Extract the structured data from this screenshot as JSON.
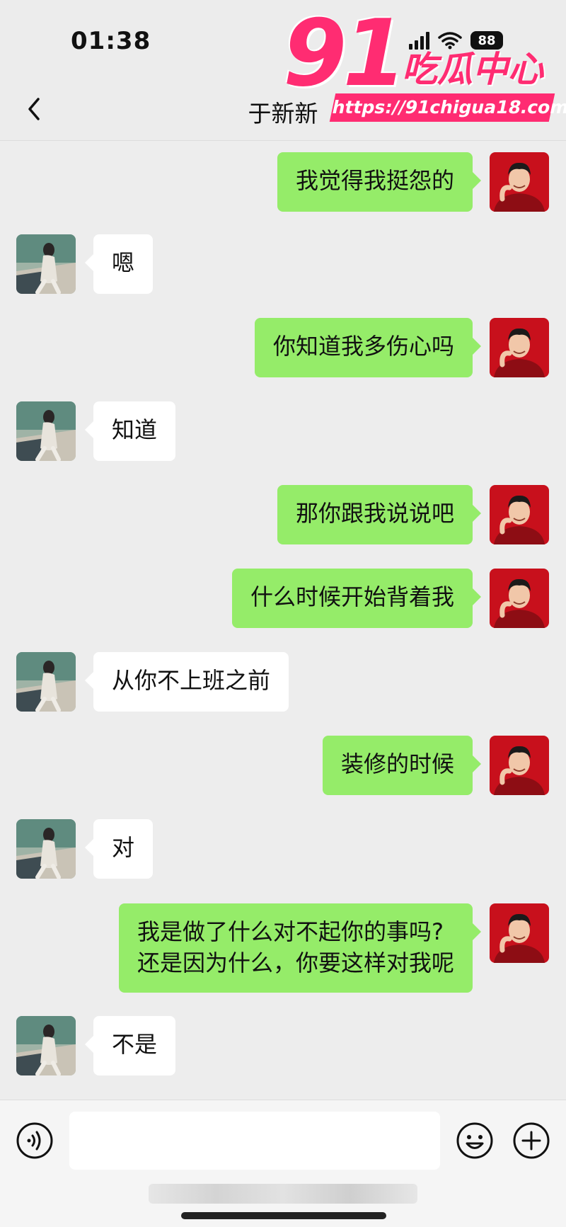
{
  "status_bar": {
    "time": "01:38",
    "battery": "88"
  },
  "header": {
    "back_icon": "chevron-left-icon",
    "title": "于新新",
    "more_label": "···"
  },
  "watermark": {
    "number": "91",
    "name": "吃瓜中心",
    "url": "https://91chigua18.com"
  },
  "messages": [
    {
      "direction": "out",
      "text": "我觉得我挺怨的"
    },
    {
      "direction": "in",
      "text": "嗯"
    },
    {
      "direction": "out",
      "text": "你知道我多伤心吗"
    },
    {
      "direction": "in",
      "text": "知道"
    },
    {
      "direction": "out",
      "text": "那你跟我说说吧"
    },
    {
      "direction": "out",
      "text": "什么时候开始背着我"
    },
    {
      "direction": "in",
      "text": "从你不上班之前"
    },
    {
      "direction": "out",
      "text": "装修的时候"
    },
    {
      "direction": "in",
      "text": "对"
    },
    {
      "direction": "out",
      "text": "我是做了什么对不起你的事吗?\n还是因为什么，你要这样对我呢"
    },
    {
      "direction": "in",
      "text": "不是"
    }
  ],
  "input_bar": {
    "voice_icon": "voice-icon",
    "input_value": "",
    "emoji_icon": "emoji-icon",
    "plus_icon": "plus-icon"
  },
  "colors": {
    "outgoing_bubble": "#95ec69",
    "incoming_bubble": "#ffffff",
    "watermark": "#ff2c72"
  }
}
